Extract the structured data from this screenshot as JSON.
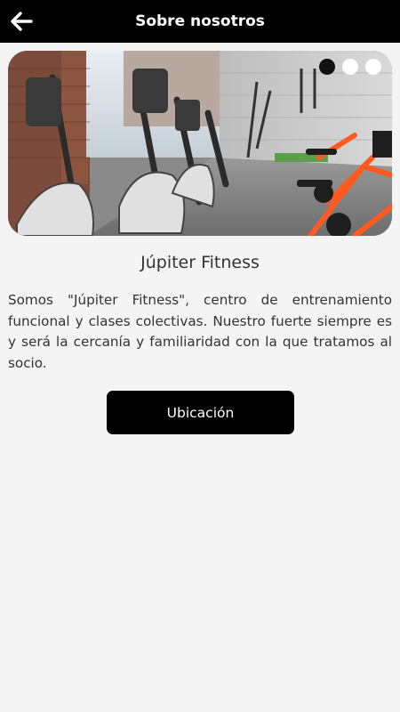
{
  "header": {
    "title": "Sobre nosotros",
    "back_icon": "arrow-left-icon"
  },
  "carousel": {
    "slide_count": 3,
    "active_index": 0,
    "image": "gym-interior-photo"
  },
  "content": {
    "title": "Júpiter Fitness",
    "description": "Somos \"Júpiter Fitness\", centro de entrenamiento funcional y clases colectivas. Nuestro fuerte siempre es y será la cercanía y familiaridad con la que tratamos al socio."
  },
  "actions": {
    "location_label": "Ubicación"
  },
  "colors": {
    "header_bg": "#000000",
    "page_bg": "#f4f4f4",
    "button_bg": "#000000",
    "bike_accent": "#ff5a1f"
  }
}
